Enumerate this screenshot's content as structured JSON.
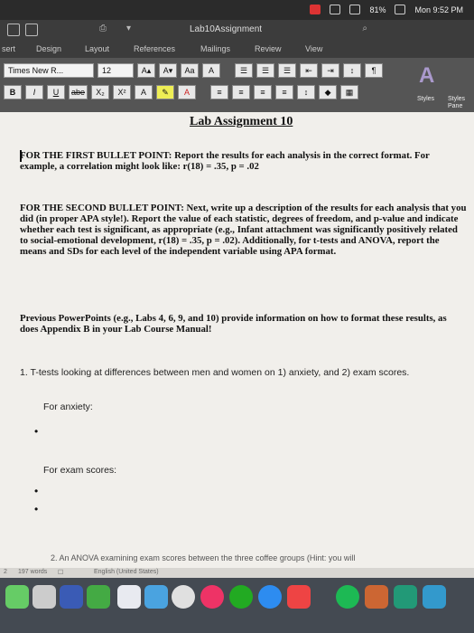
{
  "menubar": {
    "battery": "81%",
    "clock": "Mon 9:52 PM"
  },
  "window": {
    "title": "Lab10Assignment"
  },
  "tabs": [
    "sert",
    "Design",
    "Layout",
    "References",
    "Mailings",
    "Review",
    "View"
  ],
  "ribbon": {
    "font_name": "Times New R...",
    "font_size": "12",
    "bold": "B",
    "italic": "I",
    "underline": "U",
    "strike": "abe",
    "subscript": "X₂",
    "superscript": "X²",
    "styles_label": "Styles",
    "styles_pane_label": "Styles Pane"
  },
  "doc": {
    "title": "Lab Assignment 10",
    "p1": "FOR THE FIRST BULLET POINT: Report the results for each analysis in the correct format. For example, a correlation might look like: r(18) = .35, p = .02",
    "p2": "FOR THE SECOND BULLET POINT: Next, write up a description of the results for each analysis that you did (in proper APA style!). Report the value of each statistic, degrees of freedom, and p-value and indicate whether each test is significant, as appropriate (e.g., Infant attachment was significantly positively related to social-emotional development, r(18) = .35, p = .02). Additionally, for t-tests and ANOVA, report the means and SDs for each level of the independent variable using APA format.",
    "p3": "Previous PowerPoints (e.g., Labs 4, 6, 9, and 10) provide information on how to format these results, as does Appendix B in your Lab Course Manual!",
    "q1": "1. T-tests looking at differences between men and women on 1) anxiety, and 2) exam scores.",
    "for_anxiety": "For anxiety:",
    "for_exam": "For exam scores:",
    "bullet": "•",
    "q2_partial": "2. An ANOVA examining exam scores between the three coffee groups (Hint: you will"
  },
  "status": {
    "page": "2",
    "words": "197 words",
    "language": "English (United States)"
  }
}
